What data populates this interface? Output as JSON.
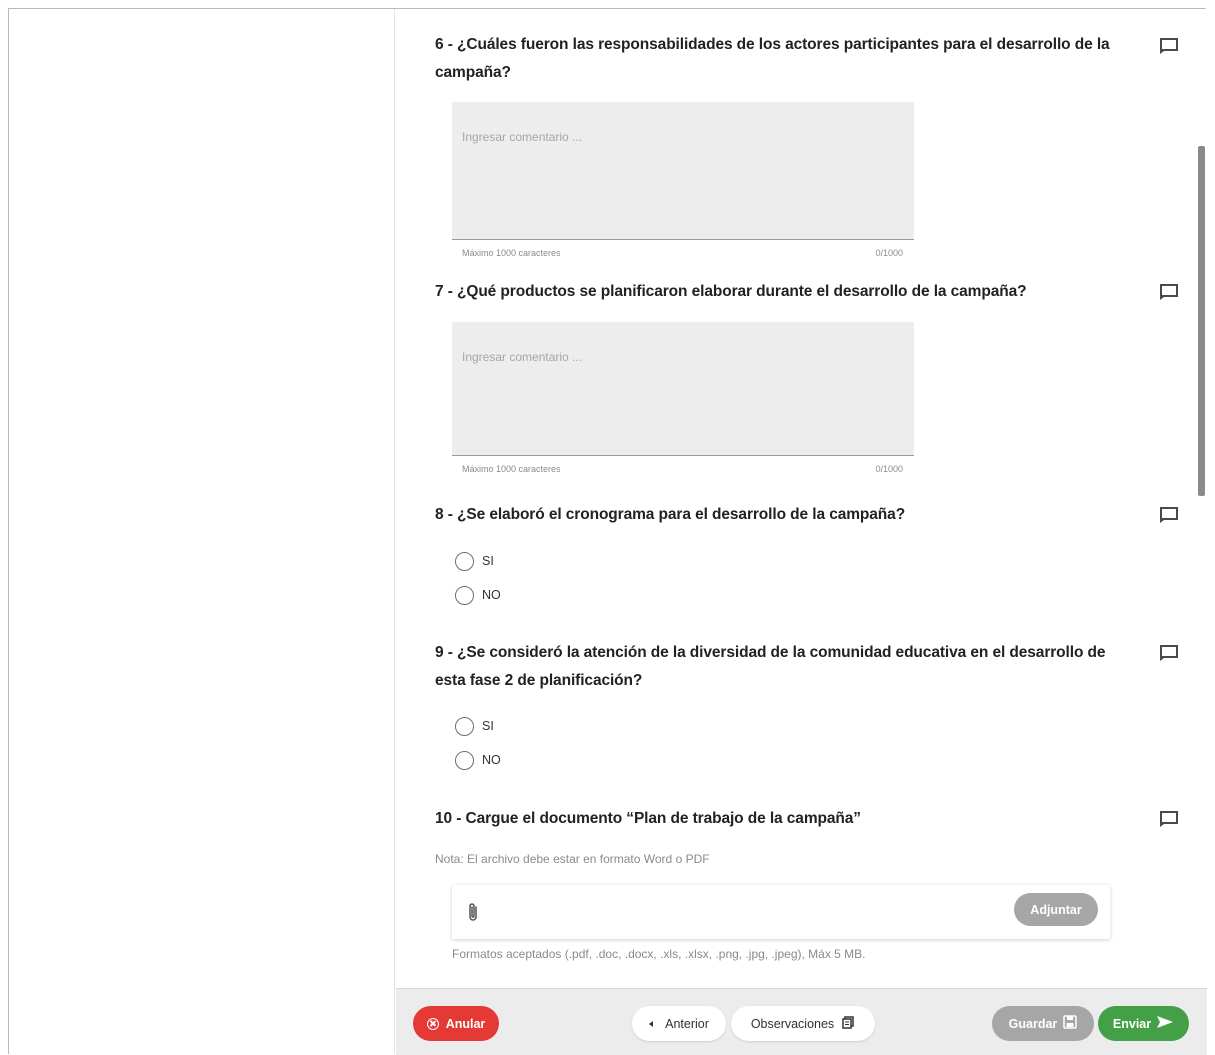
{
  "questions": [
    {
      "number": "6",
      "text": "6 - ¿Cuáles fueron las responsabilidades de los actores participantes para el desarrollo de la campaña?"
    },
    {
      "number": "7",
      "text": "7 - ¿Qué productos se planificaron elaborar durante el desarrollo de la campaña?"
    },
    {
      "number": "8",
      "text": "8 - ¿Se elaboró el cronograma para el desarrollo de la campaña?"
    },
    {
      "number": "9",
      "text": "9 - ¿Se consideró la atención de la diversidad de la comunidad educativa en el desarrollo de esta fase 2 de planificación?"
    },
    {
      "number": "10",
      "text": "10 - Cargue el documento “Plan de trabajo de la campaña”"
    }
  ],
  "textarea": {
    "placeholder": "Ingresar comentario ...",
    "max_label": "Máximo 1000 caracteres",
    "counter": "0/1000"
  },
  "radio_options": [
    "SI",
    "NO"
  ],
  "upload": {
    "note": "Nota: El archivo debe estar en formato Word o PDF",
    "attach_label": "Adjuntar",
    "formats": "Formatos aceptados (.pdf, .doc, .docx, .xls, .xlsx, .png, .jpg, .jpeg), Máx 5 MB."
  },
  "footer": {
    "anular": "Anular",
    "anterior": "Anterior",
    "observaciones": "Observaciones",
    "guardar": "Guardar",
    "enviar": "Enviar"
  },
  "colors": {
    "anular": "#e53935",
    "enviar": "#43a047",
    "disabled": "#a6a6a6"
  },
  "icons": [
    "comment-icon",
    "paperclip-icon",
    "copy-icon",
    "save-icon",
    "send-icon",
    "cancel-icon",
    "chevron-left-icon"
  ]
}
